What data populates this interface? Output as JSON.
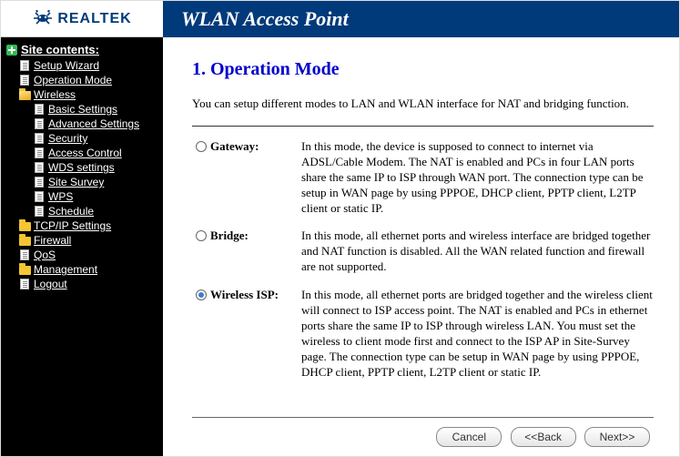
{
  "logo": {
    "text": "REALTEK"
  },
  "header_title": "WLAN Access Point",
  "sidebar": {
    "title": "Site contents:",
    "items": [
      {
        "label": "Setup Wizard",
        "icon": "page",
        "level": 1
      },
      {
        "label": "Operation Mode",
        "icon": "page",
        "level": 1
      },
      {
        "label": "Wireless",
        "icon": "folder-open",
        "level": 1
      },
      {
        "label": "Basic Settings",
        "icon": "page",
        "level": 2
      },
      {
        "label": "Advanced Settings",
        "icon": "page",
        "level": 2
      },
      {
        "label": "Security",
        "icon": "page",
        "level": 2
      },
      {
        "label": "Access Control",
        "icon": "page",
        "level": 2
      },
      {
        "label": "WDS settings",
        "icon": "page",
        "level": 2
      },
      {
        "label": "Site Survey",
        "icon": "page",
        "level": 2
      },
      {
        "label": "WPS",
        "icon": "page",
        "level": 2
      },
      {
        "label": "Schedule",
        "icon": "page",
        "level": 2
      },
      {
        "label": "TCP/IP Settings",
        "icon": "folder",
        "level": 1
      },
      {
        "label": "Firewall",
        "icon": "folder",
        "level": 1
      },
      {
        "label": "QoS",
        "icon": "page",
        "level": 1
      },
      {
        "label": "Management",
        "icon": "folder",
        "level": 1
      },
      {
        "label": "Logout",
        "icon": "page",
        "level": 1
      }
    ]
  },
  "main": {
    "title": "1. Operation Mode",
    "intro": "You can setup different modes to LAN and WLAN interface for NAT and bridging function.",
    "options": [
      {
        "id": "gateway",
        "label": "Gateway:",
        "selected": false,
        "desc": "In this mode, the device is supposed to connect to internet via ADSL/Cable Modem. The NAT is enabled and PCs in four LAN ports share the same IP to ISP through WAN port. The connection type can be setup in WAN page by using PPPOE, DHCP client, PPTP client, L2TP client or static IP."
      },
      {
        "id": "bridge",
        "label": "Bridge:",
        "selected": false,
        "desc": "In this mode, all ethernet ports and wireless interface are bridged together and NAT function is disabled. All the WAN related function and firewall are not supported."
      },
      {
        "id": "wireless-isp",
        "label": "Wireless ISP:",
        "selected": true,
        "desc": "In this mode, all ethernet ports are bridged together and the wireless client will connect to ISP access point. The NAT is enabled and PCs in ethernet ports share the same IP to ISP through wireless LAN. You must set the wireless to client mode first and connect to the ISP AP in Site-Survey page. The connection type can be setup in WAN page by using PPPOE, DHCP client, PPTP client, L2TP client or static IP."
      }
    ],
    "buttons": {
      "cancel": "Cancel",
      "back": "<<Back",
      "next": "Next>>"
    }
  }
}
